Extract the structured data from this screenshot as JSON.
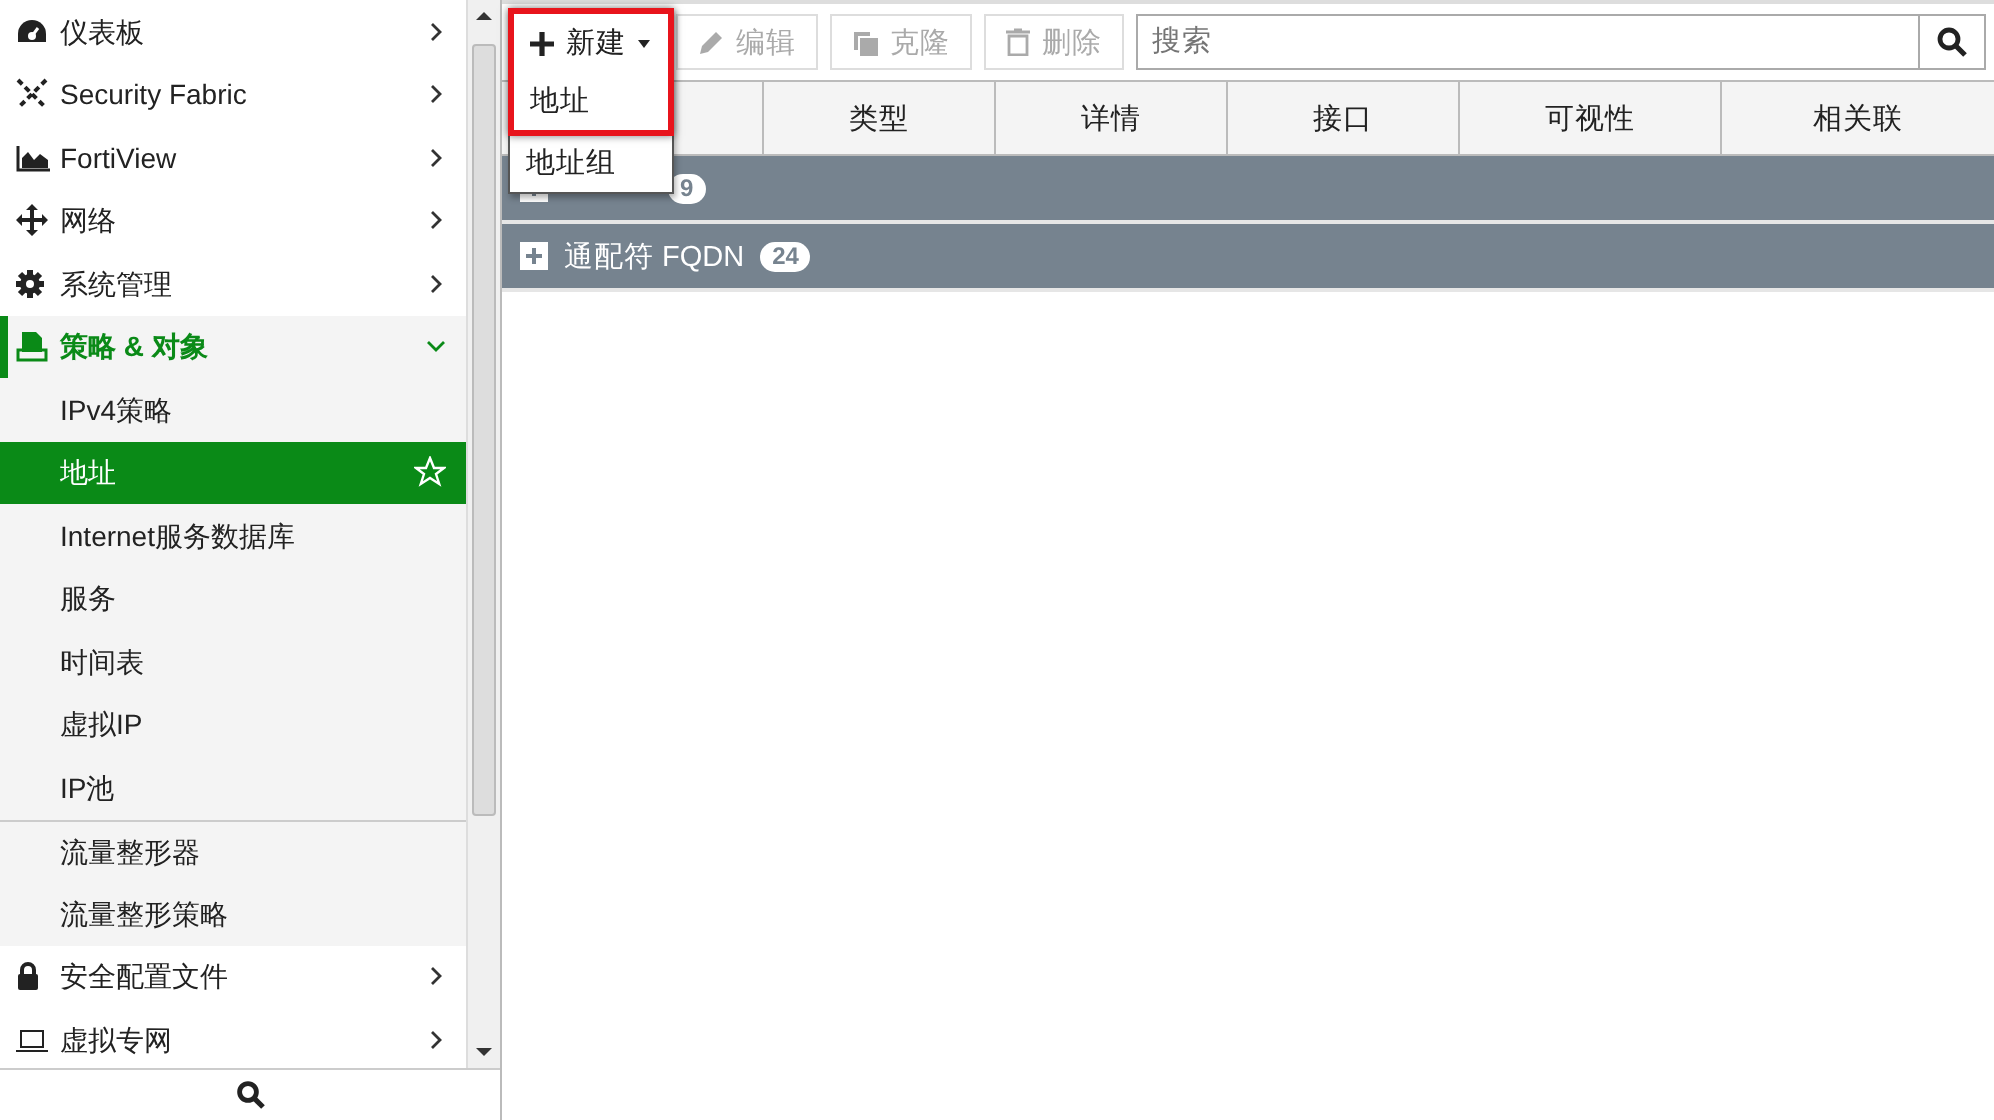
{
  "sidebar": {
    "items": [
      {
        "label": "仪表板",
        "expanded": false
      },
      {
        "label": "Security Fabric",
        "expanded": false
      },
      {
        "label": "FortiView",
        "expanded": false
      },
      {
        "label": "网络",
        "expanded": false
      },
      {
        "label": "系统管理",
        "expanded": false
      },
      {
        "label": "策略 & 对象",
        "expanded": true,
        "children": [
          {
            "label": "IPv4策略",
            "selected": false,
            "separator_above": false
          },
          {
            "label": "地址",
            "selected": true,
            "separator_above": false
          },
          {
            "label": "Internet服务数据库",
            "selected": false,
            "separator_above": false
          },
          {
            "label": "服务",
            "selected": false,
            "separator_above": false
          },
          {
            "label": "时间表",
            "selected": false,
            "separator_above": false
          },
          {
            "label": "虚拟IP",
            "selected": false,
            "separator_above": false
          },
          {
            "label": "IP池",
            "selected": false,
            "separator_above": false
          },
          {
            "label": "流量整形器",
            "selected": false,
            "separator_above": true
          },
          {
            "label": "流量整形策略",
            "selected": false,
            "separator_above": false
          }
        ]
      },
      {
        "label": "安全配置文件",
        "expanded": false
      },
      {
        "label": "虚拟专网",
        "expanded": false
      }
    ]
  },
  "toolbar": {
    "buttons": [
      {
        "label": "新建",
        "disabled": false
      },
      {
        "label": "编辑",
        "disabled": true
      },
      {
        "label": "克隆",
        "disabled": true
      },
      {
        "label": "删除",
        "disabled": true
      }
    ],
    "search": {
      "placeholder": "搜索"
    }
  },
  "new_menu": {
    "items": [
      {
        "label": "地址",
        "highlighted": true
      },
      {
        "label": "地址组",
        "highlighted": false
      }
    ]
  },
  "table": {
    "columns": [
      "",
      "类型",
      "详情",
      "接口",
      "可视性",
      "相关联"
    ],
    "groups": [
      {
        "count": "9"
      },
      {
        "label": "通配符 FQDN",
        "count": "24"
      }
    ]
  }
}
